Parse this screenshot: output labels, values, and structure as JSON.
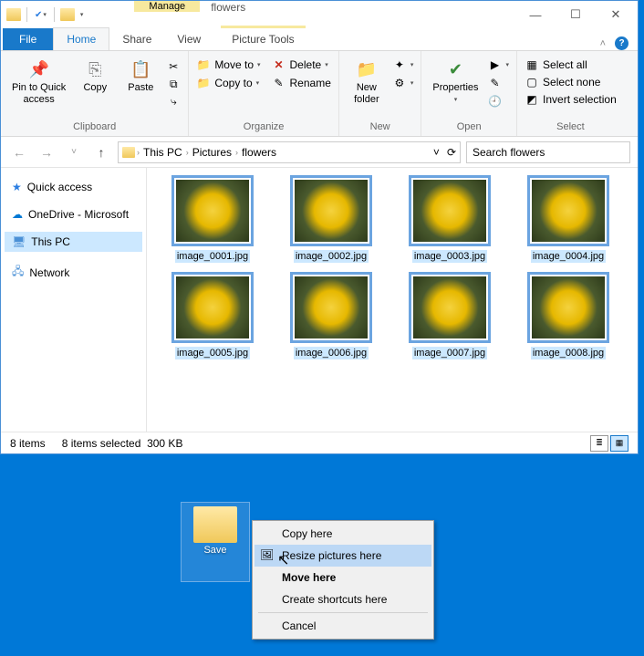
{
  "titlebar": {
    "contextual_label": "Manage",
    "window_title": "flowers"
  },
  "tabs": {
    "file": "File",
    "home": "Home",
    "share": "Share",
    "view": "View",
    "picture_tools": "Picture Tools"
  },
  "ribbon": {
    "clipboard": {
      "label": "Clipboard",
      "pin": "Pin to Quick\naccess",
      "copy": "Copy",
      "paste": "Paste"
    },
    "organize": {
      "label": "Organize",
      "move_to": "Move to",
      "copy_to": "Copy to",
      "delete": "Delete",
      "rename": "Rename"
    },
    "new": {
      "label": "New",
      "new_folder": "New\nfolder"
    },
    "open": {
      "label": "Open",
      "properties": "Properties"
    },
    "select": {
      "label": "Select",
      "select_all": "Select all",
      "select_none": "Select none",
      "invert": "Invert selection"
    }
  },
  "breadcrumb": {
    "root": "This PC",
    "p1": "Pictures",
    "p2": "flowers"
  },
  "search": {
    "placeholder": "Search flowers"
  },
  "nav": {
    "quick_access": "Quick access",
    "onedrive": "OneDrive - Microsoft",
    "this_pc": "This PC",
    "network": "Network"
  },
  "files": [
    {
      "name": "image_0001.jpg"
    },
    {
      "name": "image_0002.jpg"
    },
    {
      "name": "image_0003.jpg"
    },
    {
      "name": "image_0004.jpg"
    },
    {
      "name": "image_0005.jpg"
    },
    {
      "name": "image_0006.jpg"
    },
    {
      "name": "image_0007.jpg"
    },
    {
      "name": "image_0008.jpg"
    }
  ],
  "status": {
    "count": "8 items",
    "selected": "8 items selected",
    "size": "300 KB"
  },
  "desktop": {
    "folder_label": "Save"
  },
  "context_menu": {
    "copy_here": "Copy here",
    "resize_here": "Resize pictures here",
    "move_here": "Move here",
    "shortcuts": "Create shortcuts here",
    "cancel": "Cancel"
  }
}
